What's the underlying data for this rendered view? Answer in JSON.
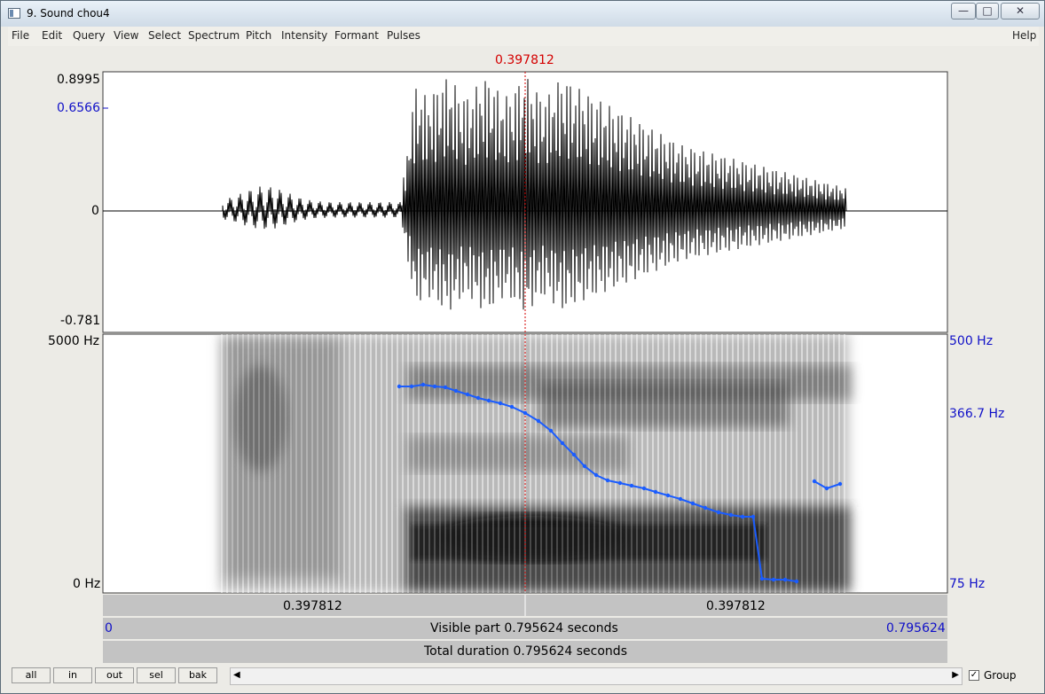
{
  "window": {
    "title": "9. Sound chou4"
  },
  "menus": [
    "File",
    "Edit",
    "Query",
    "View",
    "Select",
    "Spectrum",
    "Pitch",
    "Intensity",
    "Formant",
    "Pulses"
  ],
  "help_label": "Help",
  "cursor": {
    "time_label": "0.397812"
  },
  "waveform": {
    "max_label": "0.8995",
    "blue_label": "0.6566",
    "zero_label": "0",
    "min_label": "-0.781"
  },
  "spectrogram": {
    "top_freq": "5000 Hz",
    "bottom_freq": "0 Hz"
  },
  "pitch_axis": {
    "top": "500 Hz",
    "mid": "366.7 Hz",
    "bottom": "75 Hz"
  },
  "time_bar": {
    "left_label": "0.397812",
    "right_label": "0.397812"
  },
  "visible_bar": {
    "start": "0",
    "text": "Visible part 0.795624 seconds",
    "end": "0.795624"
  },
  "total_bar": {
    "text": "Total duration 0.795624 seconds"
  },
  "buttons": {
    "all": "all",
    "in": "in",
    "out": "out",
    "sel": "sel",
    "bak": "bak"
  },
  "group": {
    "label": "Group",
    "checked": true
  },
  "colors": {
    "cursor": "#d40000",
    "pitch": "#1a5cff",
    "axis_blue": "#1010c8"
  }
}
